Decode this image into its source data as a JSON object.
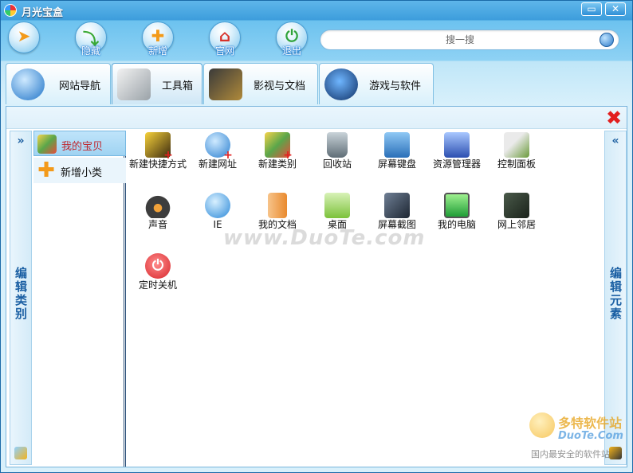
{
  "window": {
    "title": "月光宝盒",
    "minimize_label": "▭",
    "close_label": "✕"
  },
  "toolbar": {
    "buttons": [
      {
        "label": "",
        "icon": "pin-icon",
        "glyph": "➤",
        "color": "#f39a1a"
      },
      {
        "label": "隐藏",
        "icon": "hide-arrow-icon",
        "glyph": "⤵",
        "color": "#3aa935"
      },
      {
        "label": "新增",
        "icon": "add-icon",
        "glyph": "✚",
        "color": "#f39a1a"
      },
      {
        "label": "官网",
        "icon": "home-icon",
        "glyph": "⌂",
        "color": "#d8322b"
      },
      {
        "label": "退出",
        "icon": "exit-icon",
        "glyph": "⏻",
        "color": "#2fa33a"
      }
    ],
    "search": {
      "placeholder": "搜一搜",
      "value": ""
    }
  },
  "tabs": [
    {
      "label": "网站导航",
      "icon": "ie-globe-icon",
      "active": false
    },
    {
      "label": "工具箱",
      "icon": "toolbox-icon",
      "active": true
    },
    {
      "label": "影视与文档",
      "icon": "media-docs-icon",
      "active": false
    },
    {
      "label": "游戏与软件",
      "icon": "windows-logo-icon",
      "active": false
    }
  ],
  "left_strip": {
    "arrow": "»",
    "label": "编辑类别"
  },
  "right_strip": {
    "arrow": "«",
    "label": "编辑元素"
  },
  "categories": [
    {
      "label": "我的宝贝",
      "icon": "treasure-box-icon",
      "selected": true
    },
    {
      "label": "新增小类",
      "icon": "add-category-icon",
      "selected": false
    }
  ],
  "items": [
    {
      "label": "新建快捷方式",
      "icon": "new-shortcut-icon",
      "color": "#f2c21a"
    },
    {
      "label": "新建网址",
      "icon": "new-url-icon",
      "color": "#2a7fd0"
    },
    {
      "label": "新建类别",
      "icon": "new-category-icon",
      "color": "#e9a21d"
    },
    {
      "label": "回收站",
      "icon": "recycle-bin-icon",
      "color": "#6f7d86"
    },
    {
      "label": "屏幕键盘",
      "icon": "onscreen-keyboard-icon",
      "color": "#4a8fd3"
    },
    {
      "label": "资源管理器",
      "icon": "explorer-icon",
      "color": "#3b64c4"
    },
    {
      "label": "控制面板",
      "icon": "control-panel-icon",
      "color": "#6a9a3a"
    },
    {
      "label": "声音",
      "icon": "headphones-icon",
      "color": "#3d3d3d"
    },
    {
      "label": "IE",
      "icon": "ie-icon",
      "color": "#2a88d8"
    },
    {
      "label": "我的文档",
      "icon": "my-documents-icon",
      "color": "#e98a2e"
    },
    {
      "label": "桌面",
      "icon": "desktop-icon",
      "color": "#7cc23a"
    },
    {
      "label": "屏幕截图",
      "icon": "screenshot-icon",
      "color": "#2f3a4a"
    },
    {
      "label": "我的电脑",
      "icon": "my-computer-icon",
      "color": "#38b54a"
    },
    {
      "label": "网上邻居",
      "icon": "network-icon",
      "color": "#2d3d2d"
    },
    {
      "label": "定时关机",
      "icon": "timed-shutdown-icon",
      "color": "#d7262b"
    }
  ],
  "watermark": {
    "text": "www.DuoTe.com",
    "logo_title": "多特软件站",
    "logo_domain": "DuoTe.Com",
    "logo_slogan": "国内最安全的软件站"
  },
  "colors": {
    "accent": "#2e86c8",
    "selected_text": "#c0262d",
    "delete": "#e21f1f"
  }
}
